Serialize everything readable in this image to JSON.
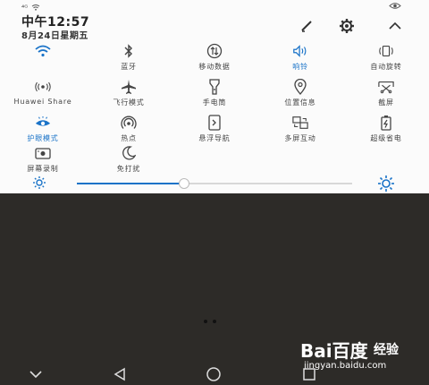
{
  "status": {
    "signal": "⁴ᴳ"
  },
  "header": {
    "time": "中午12:57",
    "date": "8月24日星期五"
  },
  "tiles": [
    {
      "label": "",
      "icon": "wifi-icon",
      "active": true
    },
    {
      "label": "蓝牙",
      "icon": "bluetooth-icon",
      "active": false
    },
    {
      "label": "移动数据",
      "icon": "mobile-data-icon",
      "active": false
    },
    {
      "label": "响铃",
      "icon": "ring-icon",
      "active": true
    },
    {
      "label": "自动旋转",
      "icon": "auto-rotate-icon",
      "active": false
    },
    {
      "label": "Huawei Share",
      "icon": "huawei-share-icon",
      "active": false
    },
    {
      "label": "飞行模式",
      "icon": "airplane-icon",
      "active": false
    },
    {
      "label": "手电筒",
      "icon": "flashlight-icon",
      "active": false
    },
    {
      "label": "位置信息",
      "icon": "location-icon",
      "active": false
    },
    {
      "label": "截屏",
      "icon": "screenshot-icon",
      "active": false
    },
    {
      "label": "护眼模式",
      "icon": "eye-comfort-icon",
      "active": true
    },
    {
      "label": "热点",
      "icon": "hotspot-icon",
      "active": false
    },
    {
      "label": "悬浮导航",
      "icon": "floating-nav-icon",
      "active": false
    },
    {
      "label": "多屏互动",
      "icon": "multi-screen-icon",
      "active": false
    },
    {
      "label": "超级省电",
      "icon": "power-saving-icon",
      "active": false
    },
    {
      "label": "屏幕录制",
      "icon": "screen-record-icon",
      "active": false
    },
    {
      "label": "免打扰",
      "icon": "do-not-disturb-icon",
      "active": false
    }
  ],
  "brightness": {
    "level": 0.39
  },
  "watermark": {
    "logo": "Bai百度",
    "text": "经验",
    "url": "jingyan.baidu.com"
  },
  "colors": {
    "accent": "#1a73c8",
    "panel": "#fbfbfb",
    "background": "#2d2b28"
  }
}
